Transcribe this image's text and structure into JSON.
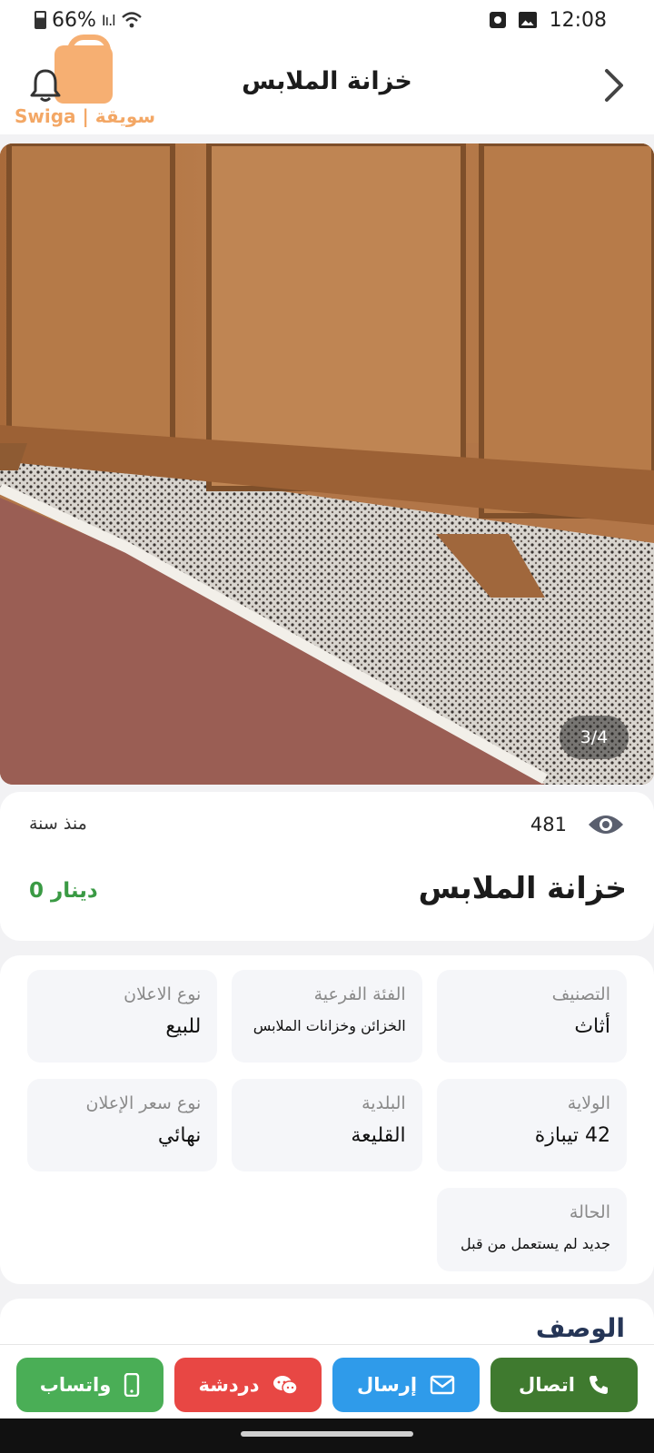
{
  "status_bar": {
    "battery": "66%",
    "time": "12:08",
    "icons": [
      "battery-icon",
      "signal-icon",
      "wifi-icon",
      "alarm-icon",
      "image-icon"
    ]
  },
  "header": {
    "title": "خزانة الملابس",
    "logo_text": "Swiga | سويقة",
    "icons": [
      "bell-icon",
      "chevron-right-icon"
    ]
  },
  "photo": {
    "counter": "3/4"
  },
  "summary": {
    "views": "481",
    "posted": "منذ سنة",
    "title": "خزانة الملابس",
    "price": "0 دينار",
    "price_color": "#3a9a44"
  },
  "details": [
    {
      "label": "التصنيف",
      "value": "أثاث"
    },
    {
      "label": "الفئة الفرعية",
      "value": "الخزائن وخزانات الملابس"
    },
    {
      "label": "نوع الاعلان",
      "value": "للبيع"
    },
    {
      "label": "الولاية",
      "value": "42 تيبازة"
    },
    {
      "label": "البلدية",
      "value": "القليعة"
    },
    {
      "label": "نوع سعر الإعلان",
      "value": "نهائي"
    },
    {
      "label": "الحالة",
      "value": "جديد لم يستعمل من قبل"
    }
  ],
  "description": {
    "title": "الوصف"
  },
  "actions": {
    "call": "اتصال",
    "send": "إرسال",
    "chat": "دردشة",
    "whatsapp": "واتساب",
    "colors": {
      "call": "#3f7a2f",
      "send": "#2f9bea",
      "chat": "#e84744",
      "whatsapp": "#4aae56"
    }
  }
}
